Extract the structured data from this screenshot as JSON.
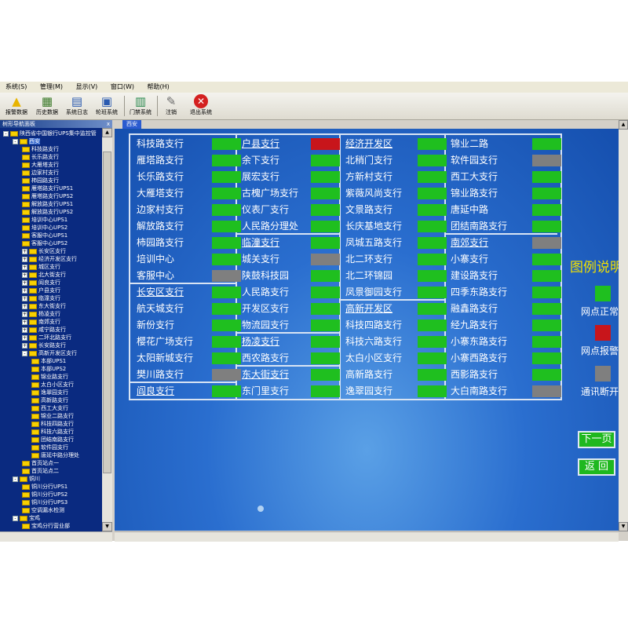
{
  "colors": {
    "normal": "#1fbf1f",
    "alarm": "#c8151b",
    "offline": "#7f7f7f"
  },
  "menu": [
    "系统(S)",
    "管理(M)",
    "显示(V)",
    "窗口(W)",
    "帮助(H)"
  ],
  "toolbar": [
    {
      "label": "报警数据",
      "icon": "warning-icon"
    },
    {
      "label": "历史数据",
      "icon": "history-icon"
    },
    {
      "label": "系统日志",
      "icon": "log-icon"
    },
    {
      "label": "轮班系统",
      "icon": "shift-icon"
    },
    {
      "label": "门禁系统",
      "icon": "access-control-icon"
    },
    {
      "label": "注销",
      "icon": "logout-icon"
    },
    {
      "label": "退出系统",
      "icon": "exit-icon"
    }
  ],
  "nav": {
    "title": "树形导航面板",
    "close": "x"
  },
  "tree": [
    {
      "label": "陕西省中国银行UPS集中监控管",
      "level": 0,
      "pm": "-",
      "sel": false
    },
    {
      "label": "西安",
      "level": 1,
      "pm": "-",
      "sel": true
    },
    {
      "label": "科技路支行",
      "level": 2,
      "pm": "",
      "sel": false
    },
    {
      "label": "长乐路支行",
      "level": 2,
      "pm": "",
      "sel": false
    },
    {
      "label": "大雁塔支行",
      "level": 2,
      "pm": "",
      "sel": false
    },
    {
      "label": "边家村支行",
      "level": 2,
      "pm": "",
      "sel": false
    },
    {
      "label": "柿园路支行",
      "level": 2,
      "pm": "",
      "sel": false
    },
    {
      "label": "雁塔路支行UPS1",
      "level": 2,
      "pm": "",
      "sel": false
    },
    {
      "label": "雁塔路支行UPS2",
      "level": 2,
      "pm": "",
      "sel": false
    },
    {
      "label": "解放路支行UPS1",
      "level": 2,
      "pm": "",
      "sel": false
    },
    {
      "label": "解放路支行UPS2",
      "level": 2,
      "pm": "",
      "sel": false
    },
    {
      "label": "培训中心UPS1",
      "level": 2,
      "pm": "",
      "sel": false
    },
    {
      "label": "培训中心UPS2",
      "level": 2,
      "pm": "",
      "sel": false
    },
    {
      "label": "客服中心UPS1",
      "level": 2,
      "pm": "",
      "sel": false
    },
    {
      "label": "客服中心UPS2",
      "level": 2,
      "pm": "",
      "sel": false
    },
    {
      "label": "长安区支行",
      "level": 2,
      "pm": "+",
      "sel": false
    },
    {
      "label": "经济开发区支行",
      "level": 2,
      "pm": "+",
      "sel": false
    },
    {
      "label": "城区支行",
      "level": 2,
      "pm": "+",
      "sel": false
    },
    {
      "label": "北大街支行",
      "level": 2,
      "pm": "+",
      "sel": false
    },
    {
      "label": "阎良支行",
      "level": 2,
      "pm": "+",
      "sel": false
    },
    {
      "label": "户县支行",
      "level": 2,
      "pm": "+",
      "sel": false
    },
    {
      "label": "临潼支行",
      "level": 2,
      "pm": "+",
      "sel": false
    },
    {
      "label": "东大街支行",
      "level": 2,
      "pm": "+",
      "sel": false
    },
    {
      "label": "杨凌支行",
      "level": 2,
      "pm": "+",
      "sel": false
    },
    {
      "label": "南郊支行",
      "level": 2,
      "pm": "+",
      "sel": false
    },
    {
      "label": "咸宁路支行",
      "level": 2,
      "pm": "+",
      "sel": false
    },
    {
      "label": "二环北路支行",
      "level": 2,
      "pm": "+",
      "sel": false
    },
    {
      "label": "长安路支行",
      "level": 2,
      "pm": "+",
      "sel": false
    },
    {
      "label": "高新开发区支行",
      "level": 2,
      "pm": "-",
      "sel": false
    },
    {
      "label": "本部UPS1",
      "level": 3,
      "pm": "",
      "sel": false
    },
    {
      "label": "本部UPS2",
      "level": 3,
      "pm": "",
      "sel": false
    },
    {
      "label": "锦业路支行",
      "level": 3,
      "pm": "",
      "sel": false
    },
    {
      "label": "太白小区支行",
      "level": 3,
      "pm": "",
      "sel": false
    },
    {
      "label": "逸翠园支行",
      "level": 3,
      "pm": "",
      "sel": false
    },
    {
      "label": "高新路支行",
      "level": 3,
      "pm": "",
      "sel": false
    },
    {
      "label": "西工大支行",
      "level": 3,
      "pm": "",
      "sel": false
    },
    {
      "label": "锦业二路支行",
      "level": 3,
      "pm": "",
      "sel": false
    },
    {
      "label": "科技四路支行",
      "level": 3,
      "pm": "",
      "sel": false
    },
    {
      "label": "科技六路支行",
      "level": 3,
      "pm": "",
      "sel": false
    },
    {
      "label": "团结南路支行",
      "level": 3,
      "pm": "",
      "sel": false
    },
    {
      "label": "软件园支行",
      "level": 3,
      "pm": "",
      "sel": false
    },
    {
      "label": "唐延中路分理处",
      "level": 3,
      "pm": "",
      "sel": false
    },
    {
      "label": "首页站点一",
      "level": 2,
      "pm": "",
      "sel": false
    },
    {
      "label": "首页站点二",
      "level": 2,
      "pm": "",
      "sel": false
    },
    {
      "label": "铜川",
      "level": 1,
      "pm": "-",
      "sel": false
    },
    {
      "label": "铜川分行UPS1",
      "level": 2,
      "pm": "",
      "sel": false
    },
    {
      "label": "铜川分行UPS2",
      "level": 2,
      "pm": "",
      "sel": false
    },
    {
      "label": "铜川分行UPS3",
      "level": 2,
      "pm": "",
      "sel": false
    },
    {
      "label": "空调漏水检测",
      "level": 2,
      "pm": "",
      "sel": false
    },
    {
      "label": "宝鸡",
      "level": 1,
      "pm": "-",
      "sel": false
    },
    {
      "label": "宝鸡分行营业部",
      "level": 2,
      "pm": "",
      "sel": false
    }
  ],
  "tab": "西安",
  "columns": [
    [
      {
        "label": "科技路支行",
        "status": "normal",
        "header": false
      },
      {
        "label": "雁塔路支行",
        "status": "normal",
        "header": false
      },
      {
        "label": "长乐路支行",
        "status": "normal",
        "header": false
      },
      {
        "label": "大雁塔支行",
        "status": "normal",
        "header": false
      },
      {
        "label": "边家村支行",
        "status": "normal",
        "header": false
      },
      {
        "label": "解放路支行",
        "status": "normal",
        "header": false
      },
      {
        "label": "柿园路支行",
        "status": "normal",
        "header": false
      },
      {
        "label": "培训中心",
        "status": "normal",
        "header": false
      },
      {
        "label": "客服中心",
        "status": "offline",
        "header": false
      },
      {
        "label": "长安区支行",
        "status": "normal",
        "header": true
      },
      {
        "label": "航天城支行",
        "status": "normal",
        "header": false
      },
      {
        "label": "新份支行",
        "status": "normal",
        "header": false
      },
      {
        "label": "樱花广场支行",
        "status": "normal",
        "header": false
      },
      {
        "label": "太阳新城支行",
        "status": "normal",
        "header": false
      },
      {
        "label": "樊川路支行",
        "status": "offline",
        "header": false
      },
      {
        "label": "阎良支行",
        "status": "normal",
        "header": true
      }
    ],
    [
      {
        "label": "户县支行",
        "status": "alarm",
        "header": true
      },
      {
        "label": "余下支行",
        "status": "normal",
        "header": false
      },
      {
        "label": "展宏支行",
        "status": "normal",
        "header": false
      },
      {
        "label": "古槐广场支行",
        "status": "normal",
        "header": false
      },
      {
        "label": "仪表厂支行",
        "status": "normal",
        "header": false
      },
      {
        "label": "人民路分理处",
        "status": "normal",
        "header": false
      },
      {
        "label": "临潼支行",
        "status": "normal",
        "header": true
      },
      {
        "label": "城关支行",
        "status": "offline",
        "header": false
      },
      {
        "label": "陕鼓科技园",
        "status": "normal",
        "header": false
      },
      {
        "label": "人民路支行",
        "status": "normal",
        "header": false
      },
      {
        "label": "开发区支行",
        "status": "normal",
        "header": false
      },
      {
        "label": "物流园支行",
        "status": "normal",
        "header": false
      },
      {
        "label": "杨凌支行",
        "status": "normal",
        "header": true
      },
      {
        "label": "西农路支行",
        "status": "normal",
        "header": false
      },
      {
        "label": "东大街支行",
        "status": "normal",
        "header": true
      },
      {
        "label": "东门里支行",
        "status": "normal",
        "header": false
      }
    ],
    [
      {
        "label": "经济开发区",
        "status": "normal",
        "header": true
      },
      {
        "label": "北稍门支行",
        "status": "normal",
        "header": false
      },
      {
        "label": "方新村支行",
        "status": "normal",
        "header": false
      },
      {
        "label": "紫薇风尚支行",
        "status": "normal",
        "header": false
      },
      {
        "label": "文景路支行",
        "status": "normal",
        "header": false
      },
      {
        "label": "长庆基地支行",
        "status": "normal",
        "header": false
      },
      {
        "label": "凤城五路支行",
        "status": "normal",
        "header": false
      },
      {
        "label": "北二环支行",
        "status": "normal",
        "header": false
      },
      {
        "label": "北二环锦园",
        "status": "normal",
        "header": false
      },
      {
        "label": "凤景御园支行",
        "status": "normal",
        "header": false
      },
      {
        "label": "高新开发区",
        "status": "normal",
        "header": true
      },
      {
        "label": "科技四路支行",
        "status": "normal",
        "header": false
      },
      {
        "label": "科技六路支行",
        "status": "normal",
        "header": false
      },
      {
        "label": "太白小区支行",
        "status": "normal",
        "header": false
      },
      {
        "label": "高新路支行",
        "status": "normal",
        "header": false
      },
      {
        "label": "逸翠园支行",
        "status": "normal",
        "header": false
      }
    ],
    [
      {
        "label": "锦业二路",
        "status": "normal",
        "header": false
      },
      {
        "label": "软件园支行",
        "status": "offline",
        "header": false
      },
      {
        "label": "西工大支行",
        "status": "normal",
        "header": false
      },
      {
        "label": "锦业路支行",
        "status": "normal",
        "header": false
      },
      {
        "label": "唐延中路",
        "status": "normal",
        "header": false
      },
      {
        "label": "团结南路支行",
        "status": "normal",
        "header": false
      },
      {
        "label": "南郊支行",
        "status": "offline",
        "header": true
      },
      {
        "label": "小寨支行",
        "status": "normal",
        "header": false
      },
      {
        "label": "建设路支行",
        "status": "normal",
        "header": false
      },
      {
        "label": "四季东路支行",
        "status": "normal",
        "header": false
      },
      {
        "label": "融鑫路支行",
        "status": "normal",
        "header": false
      },
      {
        "label": "经九路支行",
        "status": "normal",
        "header": false
      },
      {
        "label": "小寨东路支行",
        "status": "normal",
        "header": false
      },
      {
        "label": "小寨西路支行",
        "status": "normal",
        "header": false
      },
      {
        "label": "西影路支行",
        "status": "normal",
        "header": false
      },
      {
        "label": "大白南路支行",
        "status": "offline",
        "header": false
      }
    ]
  ],
  "legend": {
    "title": "图例说明",
    "normal": "网点正常",
    "alarm": "网点报警",
    "offline": "通讯断开"
  },
  "buttons": {
    "next": "下一页",
    "back": "返 回"
  }
}
